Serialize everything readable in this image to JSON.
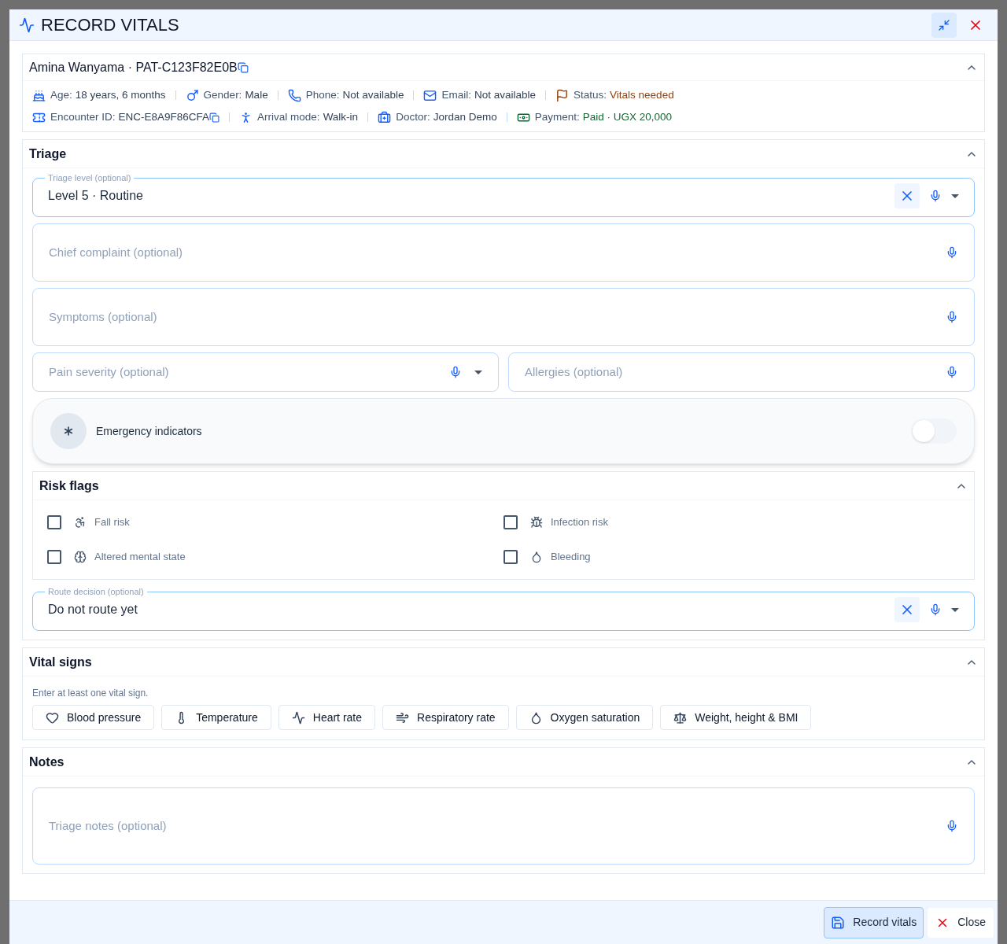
{
  "dialog": {
    "title": "RECORD VITALS"
  },
  "patient": {
    "heading": "Amina Wanyama · PAT-C123F82E0B",
    "expanded": true,
    "details_top": [
      {
        "kind": "age",
        "label": "Age:",
        "value": "18 years, 6 months",
        "color": "#334155"
      },
      {
        "kind": "gender",
        "label": "Gender:",
        "value": "Male",
        "color": "#334155"
      },
      {
        "kind": "phone",
        "label": "Phone:",
        "value": "Not available",
        "color": "#334155"
      },
      {
        "kind": "email",
        "label": "Email:",
        "value": "Not available",
        "color": "#334155"
      },
      {
        "kind": "status",
        "label": "Status:",
        "value": "Vitals needed",
        "color": "#92400e"
      }
    ],
    "details_bottom": [
      {
        "kind": "encounter",
        "label": "Encounter ID:",
        "value": "ENC-E8A9F86CFA",
        "color": "#334155",
        "copyable": true
      },
      {
        "kind": "arrival",
        "label": "Arrival mode:",
        "value": "Walk-in",
        "color": "#334155"
      },
      {
        "kind": "doctor",
        "label": "Doctor:",
        "value": "Jordan Demo",
        "color": "#334155"
      },
      {
        "kind": "payment",
        "label": "Payment:",
        "value": "Paid · UGX 20,000",
        "color": "#166534"
      }
    ]
  },
  "triage": {
    "title": "Triage",
    "expanded": true,
    "level": {
      "label": "Triage level",
      "hint": "(optional)",
      "value": "Level 5 · Routine"
    },
    "chief_complaint": {
      "placeholder": "Chief complaint (optional)"
    },
    "symptoms": {
      "placeholder": "Symptoms (optional)"
    },
    "pain": {
      "placeholder": "Pain severity (optional)"
    },
    "allergies": {
      "placeholder": "Allergies (optional)"
    },
    "emergency": {
      "label": "Emergency indicators",
      "on": false
    },
    "risk_flags": {
      "title": "Risk flags",
      "expanded": true,
      "items": [
        {
          "kind": "fall",
          "label": "Fall risk",
          "checked": false
        },
        {
          "kind": "infection",
          "label": "Infection risk",
          "checked": false
        },
        {
          "kind": "mental",
          "label": "Altered mental state",
          "checked": false
        },
        {
          "kind": "bleeding",
          "label": "Bleeding",
          "checked": false
        }
      ]
    },
    "route": {
      "label": "Route decision",
      "hint": "(optional)",
      "value": "Do not route yet"
    }
  },
  "vitals": {
    "title": "Vital signs",
    "expanded": true,
    "hint": "Enter at least one vital sign.",
    "buttons": [
      {
        "kind": "bp",
        "label": "Blood pressure"
      },
      {
        "kind": "temp",
        "label": "Temperature"
      },
      {
        "kind": "hr",
        "label": "Heart rate"
      },
      {
        "kind": "rr",
        "label": "Respiratory rate"
      },
      {
        "kind": "spo2",
        "label": "Oxygen saturation"
      },
      {
        "kind": "weight",
        "label": "Weight, height & BMI"
      }
    ]
  },
  "notes": {
    "title": "Notes",
    "expanded": true,
    "placeholder": "Triage notes (optional)"
  },
  "footer": {
    "primary": "Record vitals",
    "close": "Close"
  }
}
